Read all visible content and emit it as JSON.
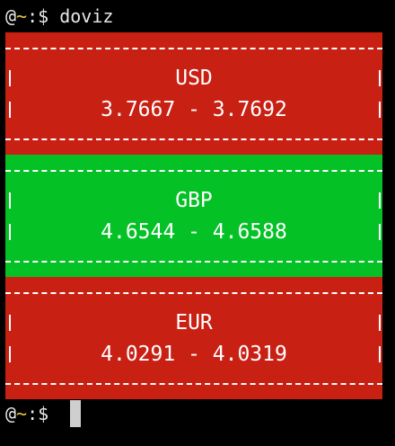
{
  "terminal": {
    "prompt_at": "@",
    "prompt_tilde": "~",
    "prompt_suffix": ":$ ",
    "command": "doviz"
  },
  "currencies": [
    {
      "code": "USD",
      "rate": "3.7667 - 3.7692",
      "color": "#c92014"
    },
    {
      "code": "GBP",
      "rate": "4.6544 - 4.6588",
      "color": "#04c126"
    },
    {
      "code": "EUR",
      "rate": "4.0291 - 4.0319",
      "color": "#c92014"
    }
  ],
  "colors": {
    "background": "#000000",
    "text": "#e9e9e9",
    "tilde": "#e8c84a",
    "down": "#c92014",
    "up": "#04c126",
    "cursor": "#cfcfcf"
  }
}
